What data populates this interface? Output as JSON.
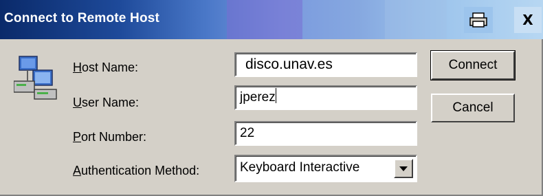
{
  "window": {
    "title": "Connect to Remote Host",
    "printer_icon": "printer-icon",
    "close_glyph": "X"
  },
  "form": {
    "host_icon": "network-host-icon",
    "host_name": {
      "label_underline": "H",
      "label_rest": "ost Name:",
      "value": "disco.unav.es"
    },
    "user_name": {
      "label_underline": "U",
      "label_rest": "ser Name:",
      "value": "jperez"
    },
    "port_number": {
      "label_underline": "P",
      "label_rest": "ort Number:",
      "value": "22"
    },
    "auth_method": {
      "label_underline": "A",
      "label_rest": "uthentication Method:",
      "value": "Keyboard Interactive"
    }
  },
  "buttons": {
    "connect": "Connect",
    "cancel": "Cancel"
  }
}
